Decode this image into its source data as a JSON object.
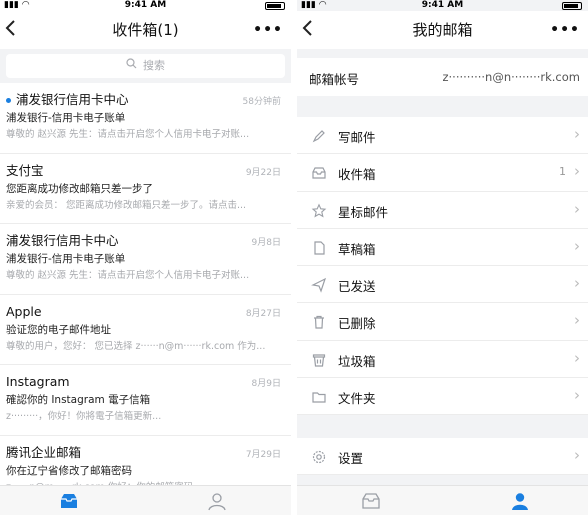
{
  "status_bar": {
    "time": "9:41 AM"
  },
  "inbox": {
    "title": "收件箱(1)",
    "more_label": "•••",
    "search_placeholder": "搜索",
    "mails": [
      {
        "sender": "浦发银行信用卡中心",
        "date": "58分钟前",
        "subject": "浦发银行-信用卡电子账单",
        "preview": "尊敬的 赵兴源 先生：请点击开启您个人信用卡电子对账...",
        "unread": true
      },
      {
        "sender": "支付宝",
        "date": "9月22日",
        "subject": "您距离成功修改邮箱只差一步了",
        "preview": "亲爱的会员：  您距离成功修改邮箱只差一步了。请点击...",
        "unread": false
      },
      {
        "sender": "浦发银行信用卡中心",
        "date": "9月8日",
        "subject": "浦发银行-信用卡电子账单",
        "preview": "尊敬的 赵兴源 先生：请点击开启您个人信用卡电子对账...",
        "unread": false
      },
      {
        "sender": "Apple",
        "date": "8月27日",
        "subject": "验证您的电子邮件地址",
        "preview": "尊敬的用户，您好：  您已选择 z······n@m······rk.com 作为...",
        "unread": false
      },
      {
        "sender": "Instagram",
        "date": "8月9日",
        "subject": "確認你的 Instagram 電子信箱",
        "preview": "z·········，你好！你將電子信箱更新...",
        "unread": false
      },
      {
        "sender": "腾讯企业邮箱",
        "date": "7月29日",
        "subject": "你在辽宁省修改了邮箱密码",
        "preview": "z······n@m······rk.com 你好：你的邮箱密码...",
        "unread": false
      }
    ]
  },
  "mailbox": {
    "title": "我的邮箱",
    "more_label": "•••",
    "account_label": "邮箱帐号",
    "account_value": "z··········n@n········rk.com",
    "items": [
      {
        "label": "写邮件",
        "icon": "compose-icon",
        "count": ""
      },
      {
        "label": "收件箱",
        "icon": "inbox-icon",
        "count": "1"
      },
      {
        "label": "星标邮件",
        "icon": "star-icon",
        "count": ""
      },
      {
        "label": "草稿箱",
        "icon": "draft-icon",
        "count": ""
      },
      {
        "label": "已发送",
        "icon": "send-icon",
        "count": ""
      },
      {
        "label": "已删除",
        "icon": "trash-icon",
        "count": ""
      },
      {
        "label": "垃圾箱",
        "icon": "junk-icon",
        "count": ""
      },
      {
        "label": "文件夹",
        "icon": "folder-icon",
        "count": ""
      }
    ],
    "settings_label": "设置"
  },
  "colors": {
    "accent": "#1a7fe0",
    "icon_gray": "#9a9ea5"
  }
}
